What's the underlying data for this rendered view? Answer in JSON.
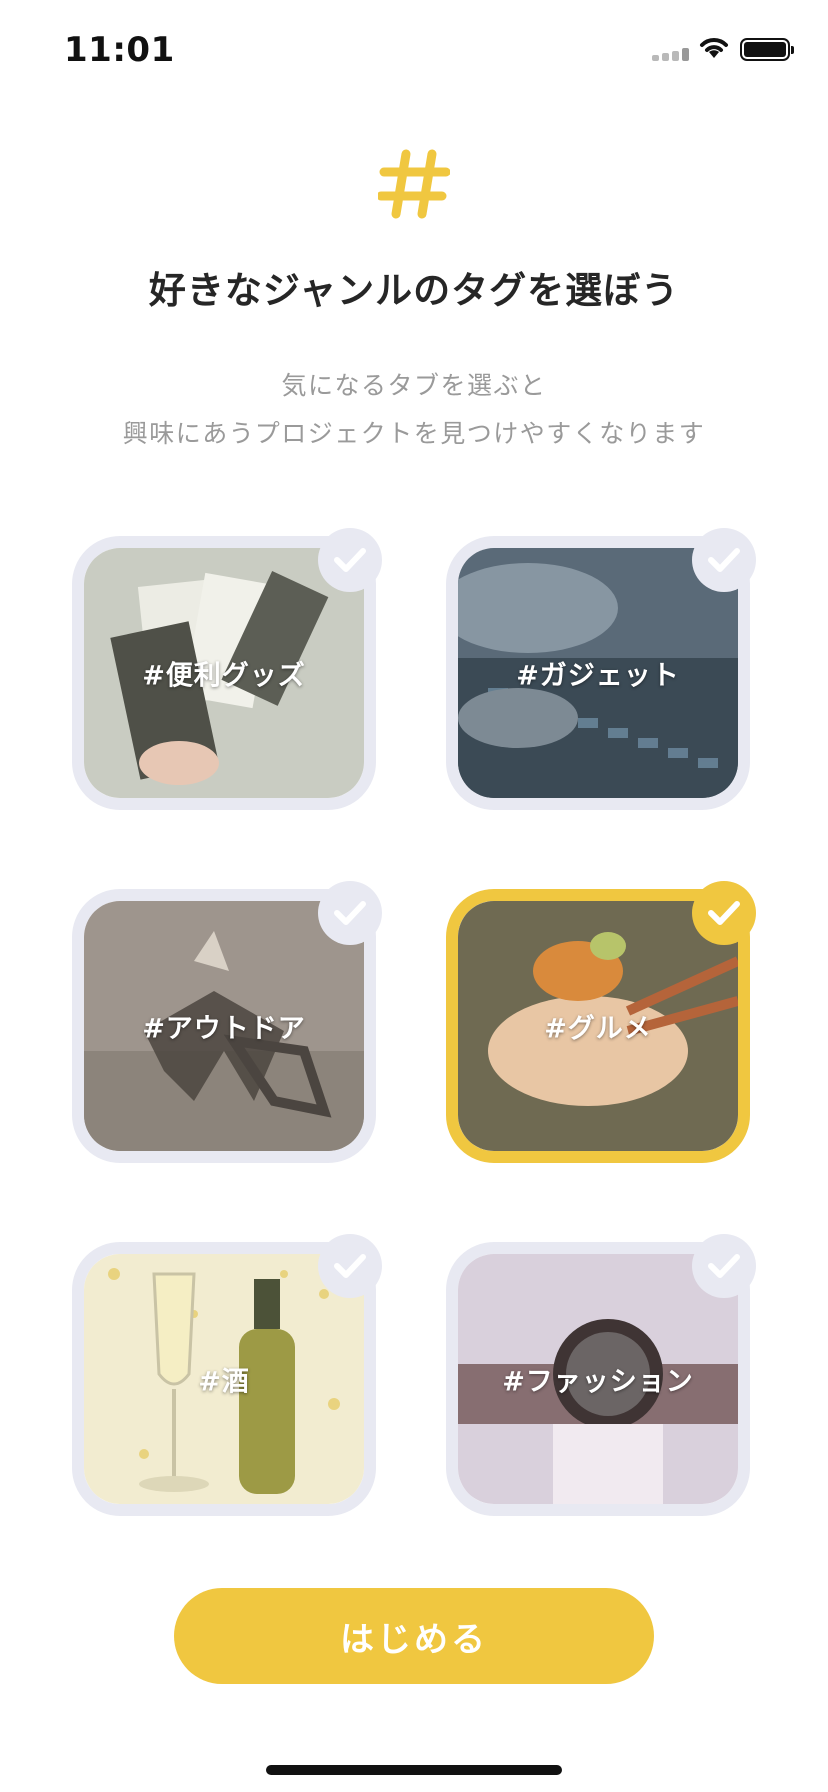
{
  "status_bar": {
    "time": "11:01"
  },
  "header": {
    "title": "好きなジャンルのタグを選ぼう",
    "subtitle_line1": "気になるタブを選ぶと",
    "subtitle_line2": "興味にあうプロジェクトを見つけやすくなります"
  },
  "tags": [
    {
      "label": "#便利グッズ",
      "selected": true
    },
    {
      "label": "#ガジェット",
      "selected": false
    },
    {
      "label": "#アウトドア",
      "selected": false
    },
    {
      "label": "#グルメ",
      "selected": true
    },
    {
      "label": "#酒",
      "selected": false
    },
    {
      "label": "#ファッション",
      "selected": false
    }
  ],
  "start_button": {
    "label": "はじめる"
  },
  "colors": {
    "accent": "#f0c740",
    "unselected_border": "#e8e9f2"
  },
  "icons": {
    "logo": "hash-icon",
    "check": "check-icon"
  }
}
